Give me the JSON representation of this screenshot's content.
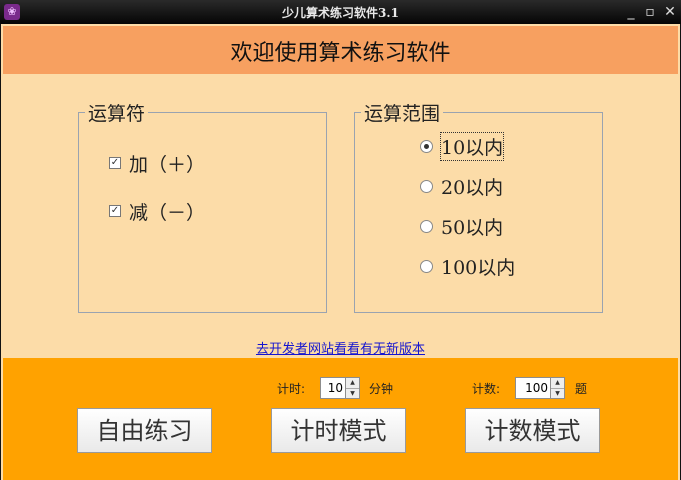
{
  "window": {
    "title": "少儿算术练习软件3.1",
    "minimize_glyph": "_",
    "maximize_glyph": "▫",
    "close_glyph": "✕",
    "app_icon_glyph": "❀"
  },
  "header": {
    "title": "欢迎使用算术练习软件"
  },
  "operators": {
    "legend": "运算符",
    "items": [
      {
        "label": "加（＋）",
        "checked": true
      },
      {
        "label": "减（－）",
        "checked": true
      }
    ]
  },
  "range": {
    "legend": "运算范围",
    "items": [
      {
        "label": "10以内",
        "selected": true
      },
      {
        "label": "20以内",
        "selected": false
      },
      {
        "label": "50以内",
        "selected": false
      },
      {
        "label": "100以内",
        "selected": false
      }
    ]
  },
  "link": {
    "text": "去开发者网站看看有无新版本"
  },
  "timer": {
    "label": "计时:",
    "value": "10",
    "unit": "分钟"
  },
  "counter": {
    "label": "计数:",
    "value": "100",
    "unit": "题"
  },
  "buttons": {
    "free": "自由练习",
    "timed": "计时模式",
    "count": "计数模式"
  },
  "colors": {
    "header_bg": "#f7a060",
    "body_bg": "#fcdca8",
    "bottom_bg": "#ffa200",
    "link": "#1515d0"
  }
}
